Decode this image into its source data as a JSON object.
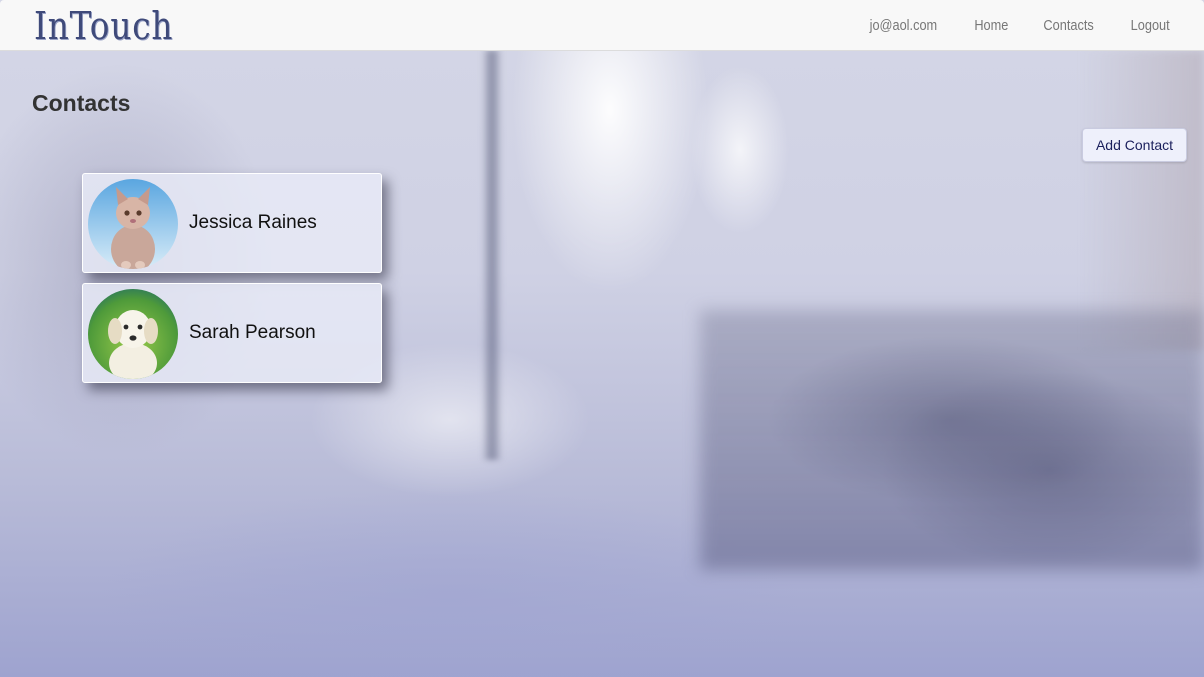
{
  "navbar": {
    "brand": "InTouch",
    "links": [
      {
        "label": "jo@aol.com"
      },
      {
        "label": "Home"
      },
      {
        "label": "Contacts"
      },
      {
        "label": "Logout"
      }
    ]
  },
  "page": {
    "title": "Contacts",
    "add_button_label": "Add Contact"
  },
  "contacts": [
    {
      "name": "Jessica Raines",
      "avatar": "kitten-photo"
    },
    {
      "name": "Sarah Pearson",
      "avatar": "puppy-photo"
    }
  ],
  "colors": {
    "navbar_bg": "#f8f8f8",
    "brand": "#3f4a7a",
    "nav_link": "#777777",
    "button_text": "#1a1f5c",
    "card_bg": "#e8eaf6"
  }
}
